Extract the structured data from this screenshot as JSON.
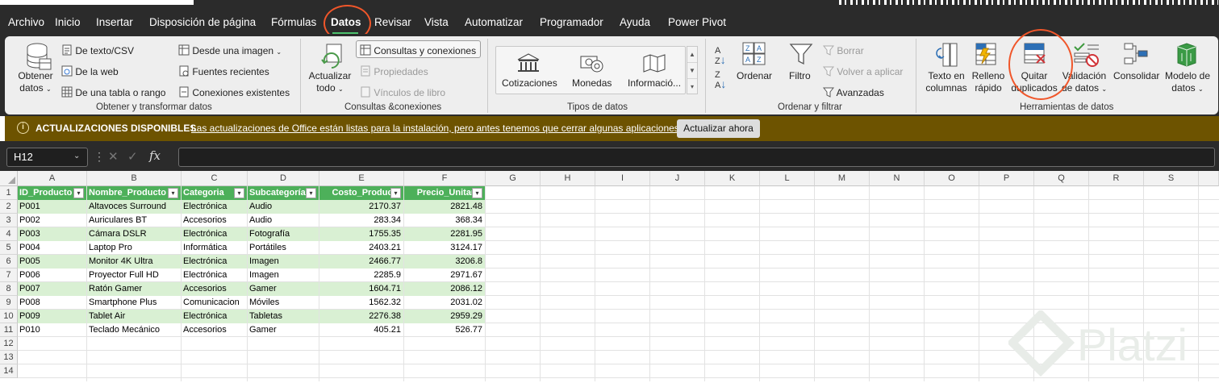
{
  "tabs": [
    "Archivo",
    "Inicio",
    "Insertar",
    "Disposición de página",
    "Fórmulas",
    "Datos",
    "Revisar",
    "Vista",
    "Automatizar",
    "Programador",
    "Ayuda",
    "Power Pivot"
  ],
  "active_tab": "Datos",
  "ribbon": {
    "obtener": {
      "obtener_datos": [
        "Obtener",
        "datos"
      ],
      "texto_csv": "De texto/CSV",
      "web": "De la web",
      "tabla_rango": "De una tabla o rango",
      "imagen": "Desde una imagen",
      "fuentes_recientes": "Fuentes recientes",
      "conexiones_existentes": "Conexiones existentes",
      "group": "Obtener y transformar datos"
    },
    "consultas": {
      "actualizar": [
        "Actualizar",
        "todo"
      ],
      "consultas_conexiones": "Consultas y conexiones",
      "propiedades": "Propiedades",
      "vinculos": "Vínculos de libro",
      "group": "Consultas &conexiones"
    },
    "tipos": {
      "cotizaciones": "Cotizaciones",
      "monedas": "Monedas",
      "informacion": "Informació...",
      "group": "Tipos de datos"
    },
    "ordenar": {
      "ordenar": "Ordenar",
      "filtro": "Filtro",
      "borrar": "Borrar",
      "volver": "Volver a aplicar",
      "avanzadas": "Avanzadas",
      "group": "Ordenar y filtrar"
    },
    "herramientas": {
      "texto_columnas": [
        "Texto en",
        "columnas"
      ],
      "relleno": [
        "Relleno",
        "rápido"
      ],
      "quitar": [
        "Quitar",
        "duplicados"
      ],
      "validacion": [
        "Validación",
        "de datos"
      ],
      "consolidar": "Consolidar",
      "modelo": [
        "Modelo de",
        "datos"
      ],
      "group": "Herramientas de datos"
    }
  },
  "message_bar": {
    "title": "ACTUALIZACIONES DISPONIBLES",
    "text": "Las actualizaciones de Office están listas para la instalación, pero antes tenemos que cerrar algunas aplicaciones.",
    "button": "Actualizar ahora"
  },
  "name_box": "H12",
  "formula_value": "",
  "columns": [
    "A",
    "B",
    "C",
    "D",
    "E",
    "F",
    "G",
    "H",
    "I",
    "J",
    "K",
    "L",
    "M",
    "N",
    "O",
    "P",
    "Q",
    "R",
    "S"
  ],
  "row_numbers": [
    "1",
    "2",
    "3",
    "4",
    "5",
    "6",
    "7",
    "8",
    "9",
    "10",
    "11",
    "12",
    "13",
    "14"
  ],
  "table": {
    "headers": [
      "ID_Producto",
      "Nombre_Producto",
      "Categoria",
      "Subcategoría",
      "Costo_Producto",
      "Precio_Unitario"
    ],
    "rows": [
      [
        "P001",
        "Altavoces Surround",
        "Electrónica",
        "Audio",
        "2170.37",
        "2821.48"
      ],
      [
        "P002",
        "Auriculares BT",
        "Accesorios",
        "Audio",
        "283.34",
        "368.34"
      ],
      [
        "P003",
        "Cámara DSLR",
        "Electrónica",
        "Fotografía",
        "1755.35",
        "2281.95"
      ],
      [
        "P004",
        "Laptop Pro",
        "Informática",
        "Portátiles",
        "2403.21",
        "3124.17"
      ],
      [
        "P005",
        "Monitor 4K Ultra",
        "Electrónica",
        "Imagen",
        "2466.77",
        "3206.8"
      ],
      [
        "P006",
        "Proyector Full HD",
        "Electrónica",
        "Imagen",
        "2285.9",
        "2971.67"
      ],
      [
        "P007",
        "Ratón Gamer",
        "Accesorios",
        "Gamer",
        "1604.71",
        "2086.12"
      ],
      [
        "P008",
        "Smartphone Plus",
        "Comunicacion",
        "Móviles",
        "1562.32",
        "2031.02"
      ],
      [
        "P009",
        "Tablet Air",
        "Electrónica",
        "Tabletas",
        "2276.38",
        "2959.29"
      ],
      [
        "P010",
        "Teclado Mecánico",
        "Accesorios",
        "Gamer",
        "405.21",
        "526.77"
      ]
    ]
  },
  "watermark": "Platzi",
  "colors": {
    "accent": "#4db05a",
    "band": "#d9f0d3",
    "message_bar": "#6d5300",
    "annotation": "#f0562a"
  }
}
